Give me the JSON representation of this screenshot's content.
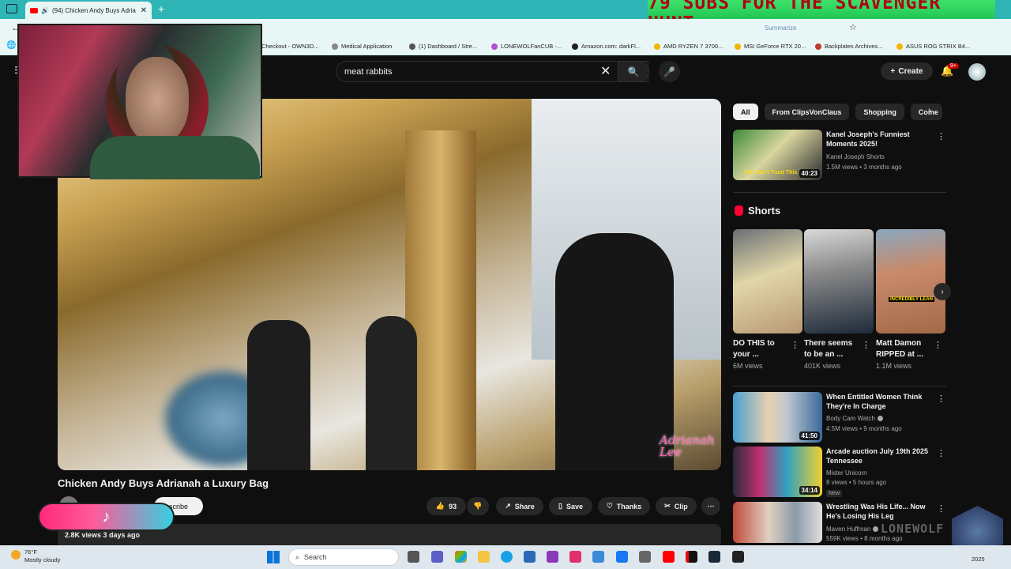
{
  "browser": {
    "active_tab_title": "(94) Chicken Andy Buys Adria",
    "bookmarks": [
      "Checkout - OWN3D...",
      "Medical Application",
      "(1) Dashboard / Stre...",
      "LONEWOLFanCUB -...",
      "Amazon.com: darkFl...",
      "AMD RYZEN 7 3700...",
      "MSI GeForce RTX 20...",
      "Backplates Archives...",
      "ASUS ROG STRIX B4..."
    ],
    "address_hint": "Summarize"
  },
  "overlay": {
    "banner_text": "79 SUBS FOR THE SCAVENGER HUNT",
    "watermark_text": "LONEWOLF",
    "player_watermark": "Adrianah Lee"
  },
  "youtube": {
    "search_value": "meat rabbits",
    "create_label": "Create",
    "notification_count": "9+"
  },
  "video": {
    "title": "Chicken Andy Buys Adrianah a Luxury Bag",
    "subscribe_label": "scribe",
    "likes": "93",
    "share_label": "Share",
    "save_label": "Save",
    "thanks_label": "Thanks",
    "clip_label": "Clip",
    "views_date": "2.8K views  3 days ago"
  },
  "sidebar": {
    "chips": [
      "All",
      "From ClipsVonClaus",
      "Shopping",
      "Come"
    ],
    "recommendations": [
      {
        "title": "Kanel Joseph's Funniest Moments 2025!",
        "channel": "Kanel Joseph Shorts",
        "meta": "1.5M views • 3 months ago",
        "duration": "40:23",
        "thumb_caption": "You Can't Trust This"
      },
      {
        "title": "When Entitled Women Think They're In Charge",
        "channel": "Body Cam Watch",
        "meta": "4.5M views • 9 months ago",
        "duration": "41:50"
      },
      {
        "title": "Arcade auction July 19th 2025 Tennessee",
        "channel": "Mister Unicorn",
        "meta": "8 views • 5 hours ago",
        "duration": "34:14",
        "badge": "New"
      },
      {
        "title": "Wrestling Was His Life... Now He's Losing His Leg",
        "channel": "Maven Huffman",
        "meta": "559K views • 8 months ago"
      }
    ],
    "shorts_heading": "Shorts",
    "shorts": [
      {
        "title": "DO THIS to your ...",
        "views": "6M views"
      },
      {
        "title": "There seems to be an ...",
        "views": "401K views"
      },
      {
        "title": "Matt Damon RIPPED at ...",
        "views": "1.1M views",
        "caption": "INCREDIBLY LEAN"
      }
    ]
  },
  "taskbar": {
    "temperature": "76°F",
    "weather": "Mostly cloudy",
    "search_placeholder": "Search",
    "year": "2025"
  }
}
